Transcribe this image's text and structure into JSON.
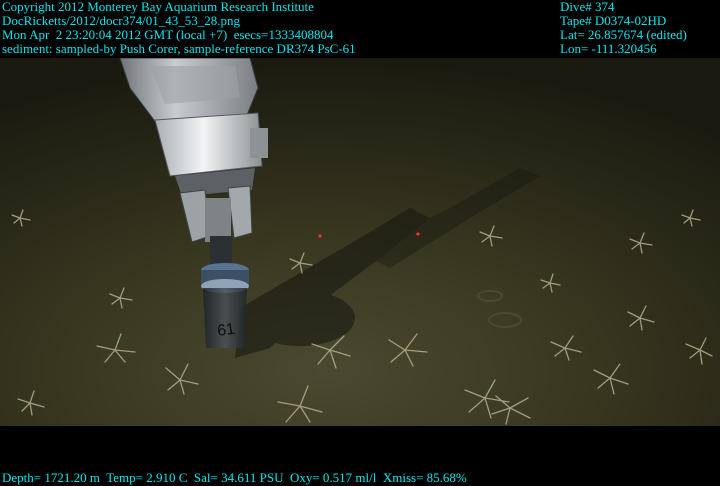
{
  "overlay": {
    "copyright": "Copyright 2012 Monterey Bay Aquarium Research Institute",
    "file_path": "DocRicketts/2012/docr374/01_43_53_28.png",
    "timestamp": "Mon Apr  2 23:20:04 2012 GMT (local +7)  esecs=1333408804",
    "sample_note": "sediment: sampled-by Push Corer, sample-reference DR374 PsC-61",
    "dive": "Dive# 374",
    "tape": "Tape# D0374-02HD",
    "lat": "Lat= 26.857674 (edited)",
    "lon": "Lon= -111.320456",
    "telemetry": "Depth= 1721.20 m  Temp= 2.910 C  Sal= 34.611 PSU  Oxy= 0.517 ml/l  Xmiss= 85.68%"
  },
  "scene": {
    "corer_label": "61",
    "colors": {
      "seafloor": "#3a3a24",
      "text": "#00e8f0"
    }
  }
}
